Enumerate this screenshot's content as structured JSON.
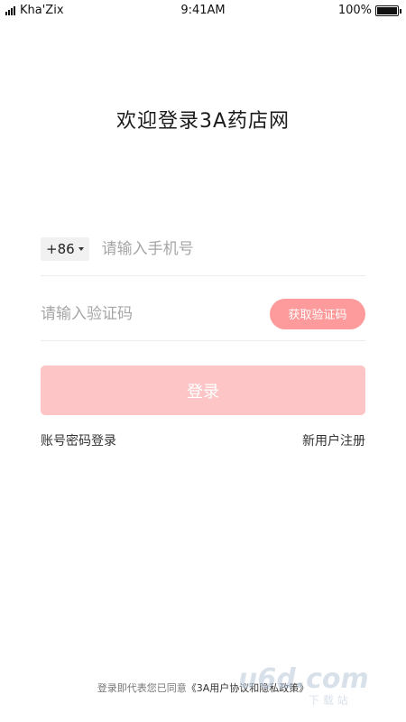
{
  "status_bar": {
    "carrier": "Kha'Zix",
    "time": "9:41AM",
    "battery": "100%",
    "battery_level": 1.0
  },
  "title": "欢迎登录3A药店网",
  "phone": {
    "country_code": "+86",
    "placeholder": "请输入手机号",
    "value": ""
  },
  "code": {
    "placeholder": "请输入验证码",
    "value": "",
    "get_code_label": "获取验证码"
  },
  "login_label": "登录",
  "links": {
    "password_login": "账号密码登录",
    "register": "新用户注册"
  },
  "agreement": {
    "prefix": "登录即代表您已同意",
    "link": "《3A用户协议和隐私政策》"
  },
  "watermark": {
    "logo_text": "u6d.com",
    "sub_text": "下 载 站"
  },
  "colors": {
    "accent": "#fd9a9b",
    "login_disabled": "#fec5c6"
  }
}
